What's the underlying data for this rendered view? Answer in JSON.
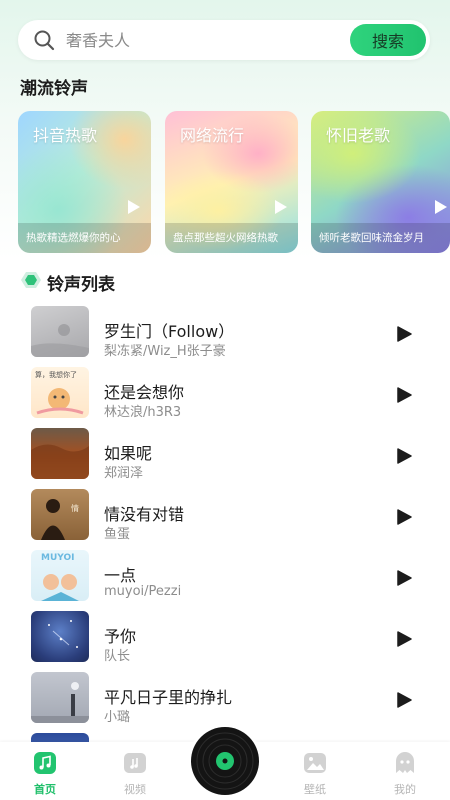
{
  "search": {
    "placeholder": "奢香夫人",
    "button_label": "搜索"
  },
  "trend_section": {
    "title": "潮流铃声"
  },
  "cards": [
    {
      "title": "抖音热歌",
      "caption": "热歌精选燃爆你的心"
    },
    {
      "title": "网络流行",
      "caption": "盘点那些超火网络热歌"
    },
    {
      "title": "怀旧老歌",
      "caption": "倾听老歌回味流金岁月"
    }
  ],
  "list_section": {
    "title": "铃声列表"
  },
  "songs": [
    {
      "title": "罗生门（Follow）",
      "artist": "梨冻紧/Wiz_H张子豪"
    },
    {
      "title": "还是会想你",
      "artist": "林达浪/h3R3"
    },
    {
      "title": "如果呢",
      "artist": "郑润泽"
    },
    {
      "title": "情没有对错",
      "artist": "鱼蛋"
    },
    {
      "title": "一点",
      "artist": "muyoi/Pezzi"
    },
    {
      "title": "予你",
      "artist": "队长"
    },
    {
      "title": "平凡日子里的挣扎",
      "artist": "小璐"
    },
    {
      "title": "",
      "artist": ""
    }
  ],
  "cover_texts": {
    "song2": "算，我想你了",
    "song5": "MUYOI"
  },
  "nav": {
    "home": "首页",
    "video": "视频",
    "wallpaper": "壁纸",
    "mine": "我的"
  },
  "colors": {
    "accent": "#1fbf6a",
    "text_secondary": "#8d8d8d"
  }
}
